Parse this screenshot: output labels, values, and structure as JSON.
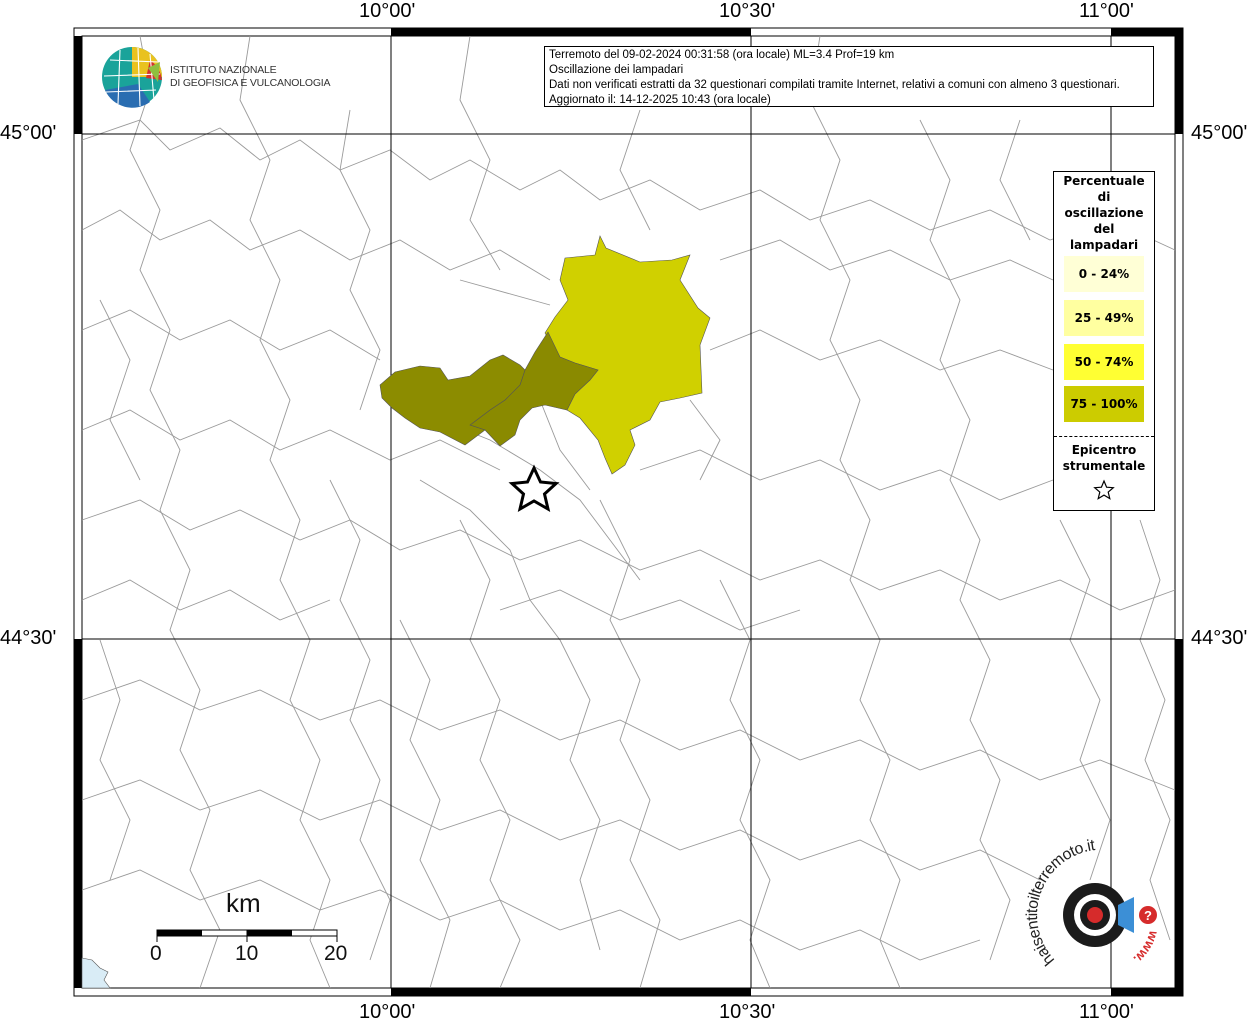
{
  "map": {
    "info_lines": [
      "Terremoto del 09-02-2024 00:31:58 (ora locale) ML=3.4 Prof=19 km",
      "Oscillazione dei lampadari",
      "Dati non verificati estratti da 32 questionari compilati tramite Internet, relativi a comuni con almeno 3 questionari.",
      "Aggiornato il: 14-12-2025 10:43 (ora locale)"
    ],
    "lon_labels": [
      "10°00'",
      "10°30'",
      "11°00'"
    ],
    "lat_labels": [
      "45°00'",
      "44°30'"
    ],
    "logo_lines": [
      "ISTITUTO NAZIONALE",
      "DI GEOFISICA E VULCANOLOGIA"
    ],
    "legend": {
      "title_lines": [
        "Percentuale",
        "di",
        "oscillazione",
        "del",
        "lampadari"
      ],
      "classes": [
        {
          "label": "0 - 24%",
          "color": "#ffffd6"
        },
        {
          "label": "25 - 49%",
          "color": "#ffffa0"
        },
        {
          "label": "50 - 74%",
          "color": "#ffff33"
        },
        {
          "label": "75 - 100%",
          "color": "#cccc00"
        }
      ],
      "epicenter_lines": [
        "Epicentro",
        "strumentale"
      ]
    },
    "areas": [
      {
        "class": "50 - 74%",
        "color": "#d0d000"
      },
      {
        "class": "75 - 100%",
        "color": "#8a8a00"
      },
      {
        "class": "75 - 100%",
        "color": "#8c8c00"
      }
    ],
    "scale": {
      "unit": "km",
      "ticks": [
        "0",
        "10",
        "20"
      ]
    },
    "badge": {
      "brand": "haisentitoilterremoto.it",
      "prefix": "www.",
      "mark": "?"
    }
  }
}
